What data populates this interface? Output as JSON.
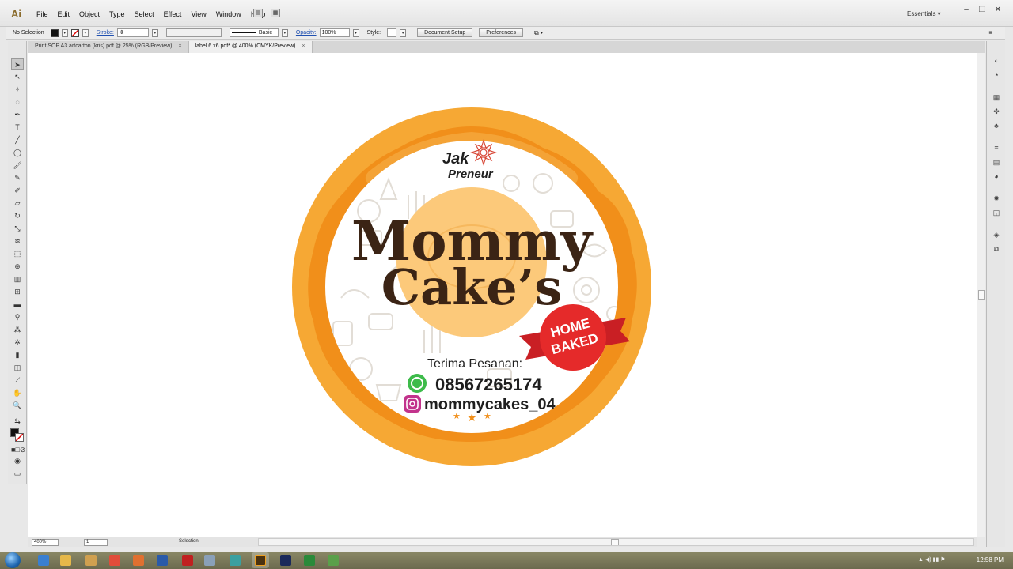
{
  "app": {
    "logo": "Ai",
    "workspace": "Essentials ▾"
  },
  "menu": [
    "File",
    "Edit",
    "Object",
    "Type",
    "Select",
    "Effect",
    "View",
    "Window",
    "Help"
  ],
  "control_bar": {
    "selection": "No Selection",
    "stroke_label": "Stroke:",
    "stroke_profile": "Basic",
    "opacity_label": "Opacity:",
    "opacity_value": "100%",
    "style_label": "Style:",
    "document_setup": "Document Setup",
    "preferences": "Preferences"
  },
  "tabs": [
    {
      "label": "Print SOP A3 artcarton (kris).pdf @ 25% (RGB/Preview)",
      "close": "×"
    },
    {
      "label": "label 6 x6.pdf* @ 400% (CMYK/Preview)",
      "close": "×"
    }
  ],
  "label": {
    "brand_top": "Jak",
    "brand_bottom": "Preneur",
    "title_line1": "Mommy",
    "title_line2": "Cake’s",
    "ribbon_line1": "HOME",
    "ribbon_line2": "BAKED",
    "order_text": "Terima Pesanan:",
    "phone": "08567265174",
    "instagram": "mommycakes_04",
    "colors": {
      "outer_ring": "#f6a834",
      "wave": "#f18f1a",
      "center_circle": "#fcc97a",
      "title": "#3b2415",
      "ribbon": "#e52a2a"
    }
  },
  "status": {
    "zoom": "400%",
    "page": "1",
    "tool": "Selection"
  },
  "taskbar": {
    "clock": "12:58 PM"
  }
}
